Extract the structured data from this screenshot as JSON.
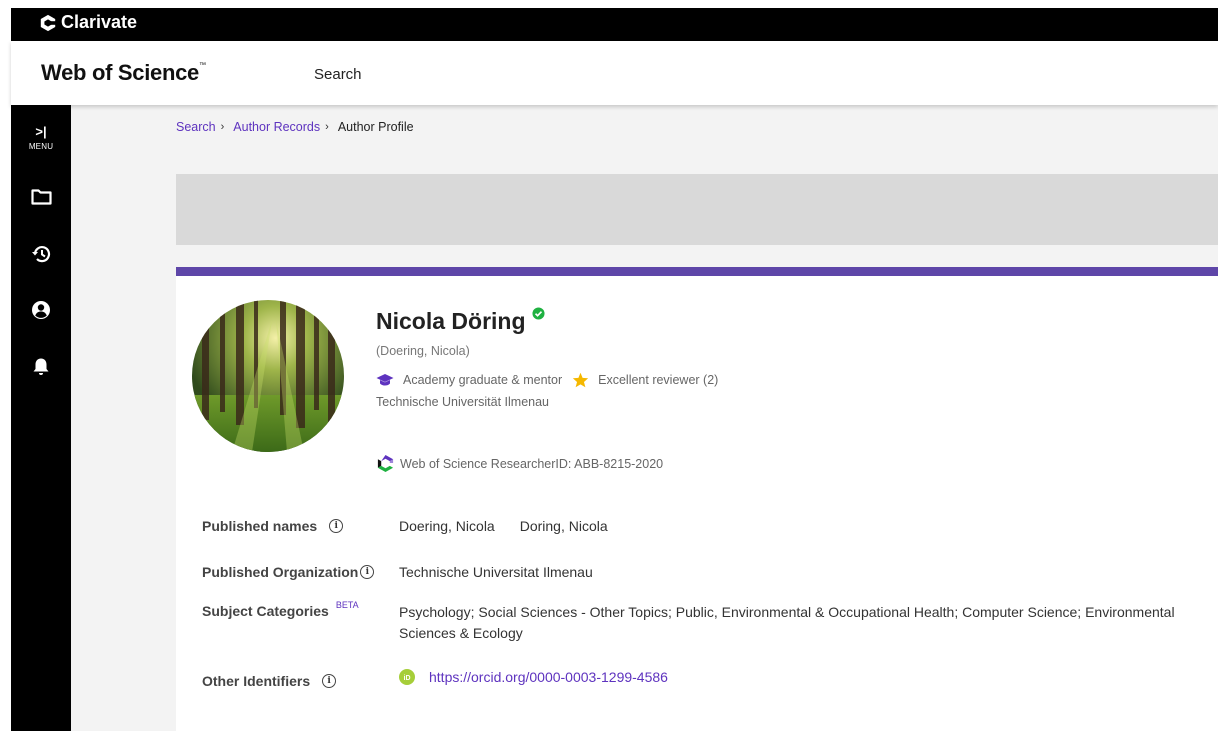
{
  "brand": {
    "name": "Clarivate"
  },
  "header": {
    "product": "Web of Science",
    "trademark": "™",
    "nav_search": "Search"
  },
  "sidebar": {
    "menu_arrow": ">|",
    "menu_label": "MENU",
    "items": [
      "folder-icon",
      "history-icon",
      "account-icon",
      "bell-icon"
    ]
  },
  "breadcrumb": {
    "items": [
      "Search",
      "Author Records"
    ],
    "separator": "›",
    "current": "Author Profile"
  },
  "profile": {
    "name": "Nicola Döring",
    "alt_name": "(Doering, Nicola)",
    "badges": [
      {
        "icon": "graduation-cap-icon",
        "label": "Academy graduate & mentor",
        "color": "#5e33bf"
      },
      {
        "icon": "star-icon",
        "label": "Excellent reviewer (2)",
        "color": "#f5b800"
      }
    ],
    "affiliation": "Technische Universität Ilmenau",
    "researcher_id": "Web of Science ResearcherID: ABB-8215-2020"
  },
  "details": {
    "published_names": {
      "label": "Published names",
      "values": [
        "Doering, Nicola",
        "Doring, Nicola"
      ]
    },
    "published_org": {
      "label": "Published Organization",
      "value": "Technische Universitat Ilmenau"
    },
    "subject_categories": {
      "label": "Subject Categories",
      "beta": "BETA",
      "value": "Psychology;  Social Sciences - Other Topics;  Public, Environmental & Occupational Health;  Computer Science;  Environmental Sciences & Ecology"
    },
    "other_identifiers": {
      "label": "Other Identifiers",
      "orcid": "https://orcid.org/0000-0003-1299-4586"
    }
  },
  "colors": {
    "accent": "#5e33bf",
    "card_top_border": "#5e46a8",
    "verified": "#1fb141",
    "orcid": "#a6ce39"
  }
}
